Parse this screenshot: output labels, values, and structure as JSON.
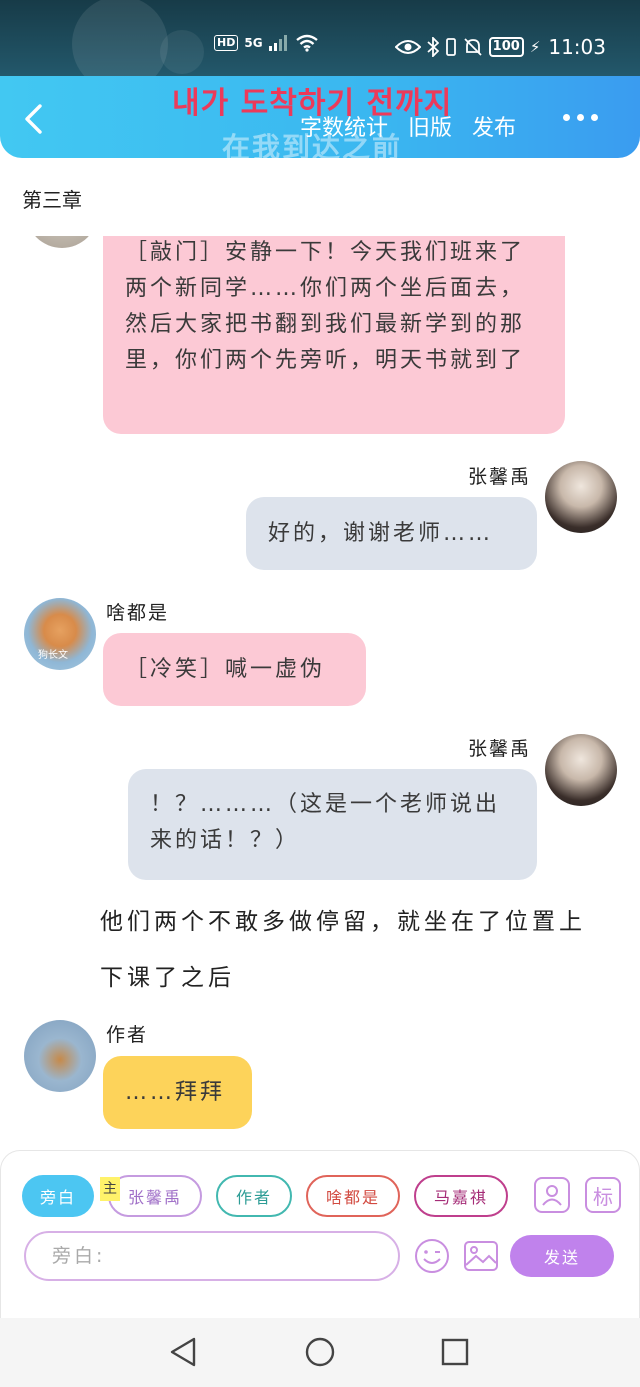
{
  "status_bar": {
    "hd": "HD",
    "network": "5G",
    "battery": "100",
    "time": "11:03"
  },
  "header": {
    "title_korean": "내가 도착하기 전까지",
    "title_chinese": "在我到达之前",
    "actions": [
      "字数统计",
      "旧版",
      "发布"
    ]
  },
  "chapter_title": "第三章",
  "messages": [
    {
      "text": "［敲门］安静一下！今天我们班来了两个新同学……你们两个坐后面去，然后大家把书翻到我们最新学到的那里，你们两个先旁听，明天书就到了",
      "style": "pink"
    },
    {
      "sender": "张馨禹",
      "text": "好的，谢谢老师……",
      "style": "gray"
    },
    {
      "sender": "啥都是",
      "text": "［冷笑］喊一虚伪",
      "style": "pink"
    },
    {
      "sender": "张馨禹",
      "text": "！？………（这是一个老师说出来的话！？）",
      "style": "gray"
    },
    {
      "narration": "他们两个不敢多做停留，就坐在了位置上"
    },
    {
      "narration": "下课了之后"
    },
    {
      "sender": "作者",
      "text": "……拜拜",
      "style": "yellow"
    }
  ],
  "avatar_caption": "狗长文",
  "role_bar": {
    "chips": [
      "旁白",
      "张馨禹",
      "作者",
      "啥都是",
      "马嘉祺"
    ],
    "main_tag": "主",
    "side_buttons": [
      "person-icon",
      "标"
    ]
  },
  "input": {
    "placeholder": "旁白:",
    "send_label": "发送"
  },
  "colors": {
    "header": "#3ab6f0",
    "pink_bubble": "#fcc9d5",
    "gray_bubble": "#dde3ec",
    "yellow_bubble": "#fdd35a",
    "send": "#c082ec"
  }
}
